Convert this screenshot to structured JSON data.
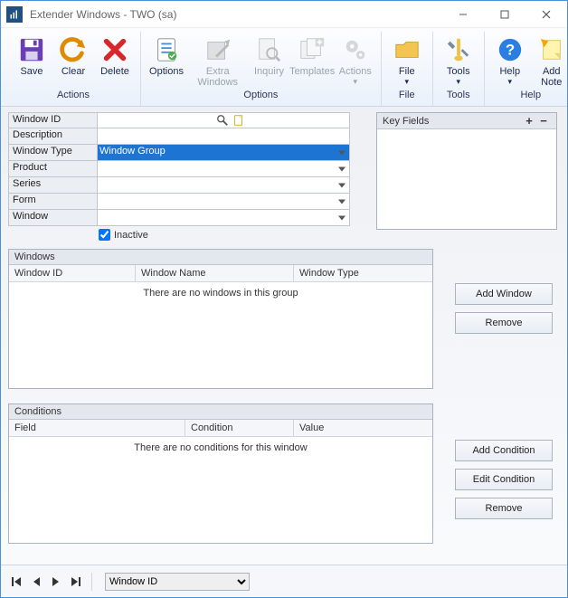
{
  "title": "Extender Windows  -  TWO (sa)",
  "ribbon": {
    "groups": [
      {
        "label": "Actions",
        "items": [
          {
            "key": "save",
            "label": "Save"
          },
          {
            "key": "clear",
            "label": "Clear"
          },
          {
            "key": "delete",
            "label": "Delete"
          }
        ]
      },
      {
        "label": "Options",
        "items": [
          {
            "key": "options",
            "label": "Options"
          },
          {
            "key": "extra",
            "label": "Extra Windows"
          },
          {
            "key": "inquiry",
            "label": "Inquiry"
          },
          {
            "key": "templates",
            "label": "Templates"
          },
          {
            "key": "actions",
            "label": "Actions"
          }
        ]
      },
      {
        "label": "File",
        "items": [
          {
            "key": "file",
            "label": "File"
          }
        ]
      },
      {
        "label": "Tools",
        "items": [
          {
            "key": "tools",
            "label": "Tools"
          }
        ]
      },
      {
        "label": "Help",
        "items": [
          {
            "key": "help",
            "label": "Help"
          },
          {
            "key": "addnote",
            "label": "Add Note"
          }
        ]
      }
    ]
  },
  "form": {
    "window_id_label": "Window ID",
    "window_id_value": "",
    "description_label": "Description",
    "description_value": "",
    "window_type_label": "Window Type",
    "window_type_value": "Window Group",
    "product_label": "Product",
    "product_value": "",
    "series_label": "Series",
    "series_value": "",
    "form_label": "Form",
    "form_value": "",
    "window_label": "Window",
    "window_value": "",
    "inactive_label": "Inactive",
    "inactive_checked": true
  },
  "key_fields": {
    "title": "Key Fields"
  },
  "windows_panel": {
    "title": "Windows",
    "cols": [
      "Window ID",
      "Window Name",
      "Window Type"
    ],
    "empty": "There are no windows in this group",
    "add_btn": "Add Window",
    "remove_btn": "Remove"
  },
  "conditions_panel": {
    "title": "Conditions",
    "cols": [
      "Field",
      "Condition",
      "Value"
    ],
    "empty": "There are no conditions for this window",
    "add_btn": "Add Condition",
    "edit_btn": "Edit Condition",
    "remove_btn": "Remove"
  },
  "footer": {
    "sort_field": "Window ID"
  }
}
